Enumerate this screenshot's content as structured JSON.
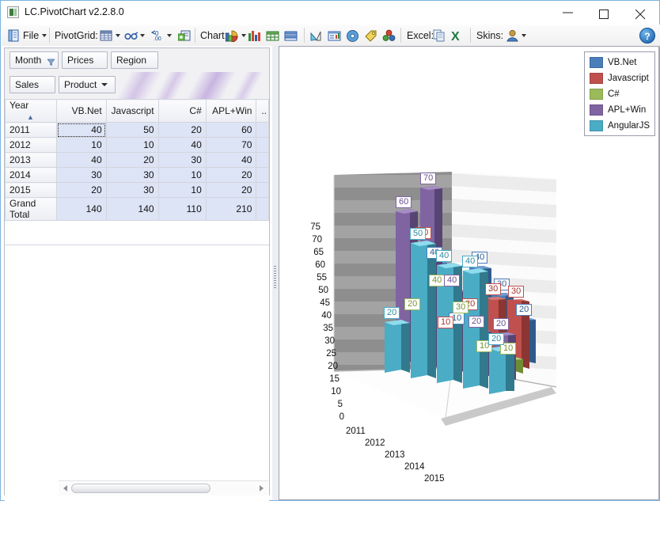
{
  "window": {
    "title": "LC.PivotChart v2.2.8.0",
    "minimize": "—",
    "maximize": "□",
    "close": "×"
  },
  "toolbar": {
    "file_label": "File",
    "pivotgrid_label": "PivotGrid:",
    "chart_label": "Chart:",
    "excel_label": "Excel:",
    "skins_label": "Skins:",
    "help_label": "?",
    "icons": [
      "file-icon",
      "pivotgrid-table-icon",
      "glasses-icon",
      "decimals-icon",
      "add-field-icon",
      "chart-pie-icon",
      "chart-bar-icon",
      "chart-grid-icon",
      "chart-split-icon",
      "chart-area-icon",
      "chart-report-icon",
      "chart-cd-icon",
      "chart-tag-icon",
      "chart-bubbles-icon",
      "excel-copy-icon",
      "excel-export-icon",
      "skins-user-icon"
    ]
  },
  "pivot": {
    "filter_fields": [
      {
        "label": "Month",
        "has_filter": true
      },
      {
        "label": "Prices",
        "has_filter": false
      },
      {
        "label": "Region",
        "has_filter": false
      }
    ],
    "data_field": "Sales",
    "column_field": "Product",
    "row_field": "Year",
    "row_sort": "▲",
    "columns": [
      "VB.Net",
      "Javascript",
      "C#",
      "APL+Win",
      ".."
    ],
    "rows": [
      {
        "label": "2011",
        "values": [
          "40",
          "50",
          "20",
          "60",
          ""
        ]
      },
      {
        "label": "2012",
        "values": [
          "10",
          "10",
          "40",
          "70",
          ""
        ]
      },
      {
        "label": "2013",
        "values": [
          "40",
          "20",
          "30",
          "40",
          ""
        ]
      },
      {
        "label": "2014",
        "values": [
          "30",
          "30",
          "10",
          "20",
          ""
        ]
      },
      {
        "label": "2015",
        "values": [
          "20",
          "30",
          "10",
          "20",
          ""
        ]
      },
      {
        "label": "Grand Total",
        "values": [
          "140",
          "140",
          "110",
          "210",
          ""
        ]
      }
    ],
    "selected_cell": {
      "row": 0,
      "col": 0
    }
  },
  "chart_data": {
    "type": "bar",
    "title": "",
    "xlabel": "",
    "ylabel": "",
    "ylim": [
      0,
      75
    ],
    "yticks": [
      "0",
      "5",
      "10",
      "15",
      "20",
      "25",
      "30",
      "35",
      "40",
      "45",
      "50",
      "55",
      "60",
      "65",
      "70",
      "75"
    ],
    "categories": [
      "2011",
      "2012",
      "2013",
      "2014",
      "2015"
    ],
    "legend_position": "top-right",
    "grid": true,
    "series": [
      {
        "name": "VB.Net",
        "color": "#4a7ebb",
        "values": [
          40,
          10,
          40,
          30,
          20
        ]
      },
      {
        "name": "Javascript",
        "color": "#c0504d",
        "values": [
          50,
          10,
          20,
          30,
          30
        ]
      },
      {
        "name": "C#",
        "color": "#9bbb59",
        "values": [
          20,
          40,
          30,
          10,
          10
        ]
      },
      {
        "name": "APL+Win",
        "color": "#8064a2",
        "values": [
          60,
          70,
          40,
          20,
          20
        ]
      },
      {
        "name": "AngularJS",
        "color": "#4bacc6",
        "values": [
          20,
          50,
          40,
          40,
          20
        ]
      }
    ]
  },
  "scrollbar": {
    "left_arrow": "◀",
    "right_arrow": "▶"
  }
}
